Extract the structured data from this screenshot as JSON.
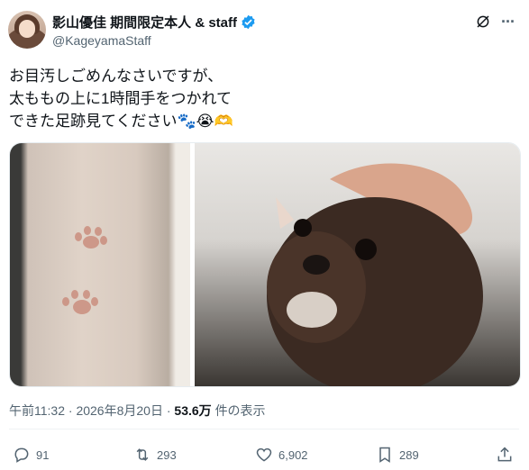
{
  "author": {
    "name": "影山優佳 期間限定本人 & staff",
    "handle": "@KageyamaStaff",
    "verified": true
  },
  "post": {
    "lines": [
      "お目汚しごめんなさいですが、",
      "太ももの上に1時間手をつかれて",
      "できた足跡見てください🐾😭🫶"
    ],
    "time": "午前11:32",
    "date": "2026年8月20日",
    "views": "53.6万",
    "views_suffix": "件の表示"
  },
  "actions": {
    "replies": "91",
    "reposts": "293",
    "likes": "6,902",
    "bookmarks": "289"
  },
  "icons": [
    "grok-icon",
    "more-icon",
    "reply-icon",
    "repost-icon",
    "like-icon",
    "bookmark-icon",
    "share-icon"
  ],
  "colors": {
    "verified": "#1d9bf0",
    "muted": "#536471"
  }
}
